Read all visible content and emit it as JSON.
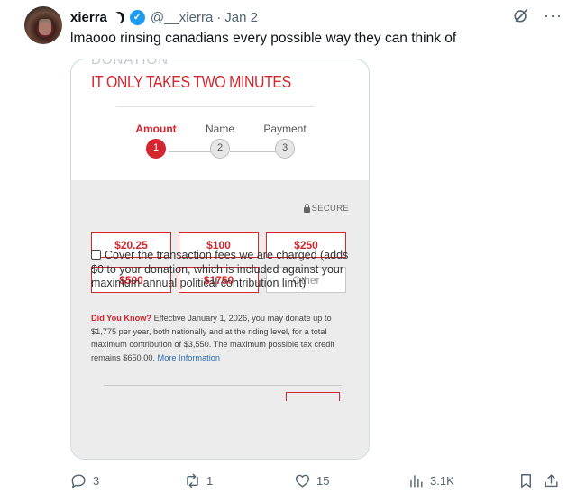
{
  "tweet": {
    "display_name": "xierra",
    "handle": "@__xierra",
    "separator": "·",
    "date": "Jan 2",
    "text": "lmaooo rinsing canadians every possible way they can think of"
  },
  "screenshot": {
    "cut_header": "DONATION",
    "title": "IT ONLY TAKES TWO MINUTES",
    "steps": [
      {
        "label": "Amount",
        "number": "1"
      },
      {
        "label": "Name",
        "number": "2"
      },
      {
        "label": "Payment",
        "number": "3"
      }
    ],
    "secure_label": "SECURE",
    "amounts": [
      "$20.25",
      "$100",
      "$250",
      "$500",
      "$1750"
    ],
    "other_placeholder": "Other",
    "fees_label": "Cover the transaction fees we are charged (adds $0 to your donation, which is included against your maximum annual political contribution limit)",
    "did_you_know_label": "Did You Know?",
    "did_you_know_text": " Effective January 1, 2026, you may donate up to $1,775 per year, both nationally and at the riding level, for a total maximum contribution of $3,550. The maximum possible tax credit remains $650.00. ",
    "more_info_link": "More Information"
  },
  "actions": {
    "replies": "3",
    "reposts": "1",
    "likes": "15",
    "views": "3.1K"
  },
  "colors": {
    "accent_red": "#d4262f",
    "twitter_blue": "#1d9bf0",
    "muted": "#536471"
  }
}
